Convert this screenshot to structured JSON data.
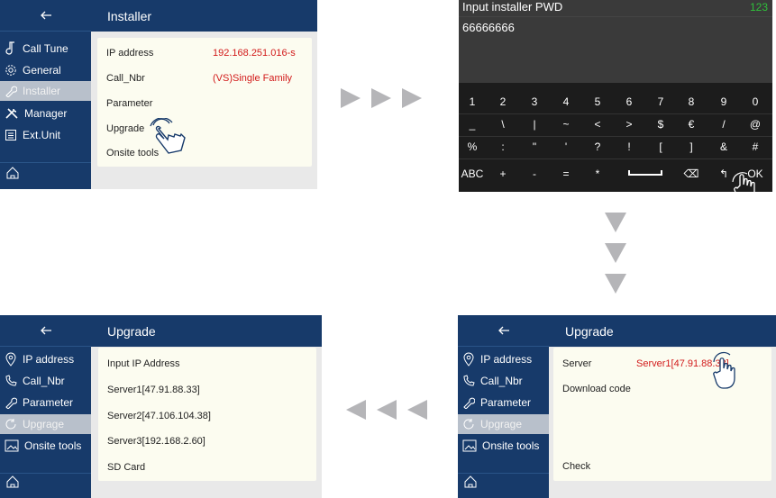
{
  "installer_screen": {
    "title": "Installer",
    "back_icon": "back-arrow-icon",
    "sidebar": [
      {
        "label": "Call Tune",
        "icon": "music-note-icon"
      },
      {
        "label": "General",
        "icon": "gear-icon"
      },
      {
        "label": "Installer",
        "icon": "wrench-icon",
        "active": true
      },
      {
        "label": "Manager",
        "icon": "tools-icon"
      },
      {
        "label": "Ext.Unit",
        "icon": "list-icon"
      }
    ],
    "rows": [
      {
        "label": "IP address",
        "value": "192.168.251.016-s"
      },
      {
        "label": "Call_Nbr",
        "value": "(VS)Single Family"
      },
      {
        "label": "Parameter",
        "value": ""
      },
      {
        "label": "Upgrade",
        "value": ""
      },
      {
        "label": "Onsite tools",
        "value": ""
      }
    ]
  },
  "keyboard_screen": {
    "title": "Input installer PWD",
    "mode": "123",
    "input_value": "66666666",
    "rows": [
      [
        "1",
        "2",
        "3",
        "4",
        "5",
        "6",
        "7",
        "8",
        "9",
        "0"
      ],
      [
        "_",
        "\\",
        "|",
        "~",
        "<",
        ">",
        "$",
        "€",
        "/",
        "@"
      ],
      [
        "%",
        ":",
        "\"",
        "'",
        "?",
        "!",
        "[",
        "]",
        "&",
        "#"
      ],
      [
        "ABC",
        "+",
        "-",
        "=",
        "*",
        "",
        "",
        "⌫",
        "↰",
        "OK"
      ]
    ]
  },
  "upgrade_left": {
    "title": "Upgrade",
    "sidebar": [
      {
        "label": "IP address",
        "icon": "location-pin-icon"
      },
      {
        "label": "Call_Nbr",
        "icon": "phone-icon"
      },
      {
        "label": "Parameter",
        "icon": "wrench-icon"
      },
      {
        "label": "Upgrage",
        "icon": "refresh-icon",
        "active": true
      },
      {
        "label": "Onsite tools",
        "icon": "picture-icon"
      }
    ],
    "rows": [
      "Input IP Address",
      "Server1[47.91.88.33]",
      "Server2[47.106.104.38]",
      "Server3[192.168.2.60]",
      "SD Card"
    ]
  },
  "upgrade_right": {
    "title": "Upgrade",
    "sidebar": [
      {
        "label": "IP address",
        "icon": "location-pin-icon"
      },
      {
        "label": "Call_Nbr",
        "icon": "phone-icon"
      },
      {
        "label": "Parameter",
        "icon": "wrench-icon"
      },
      {
        "label": "Upgrage",
        "icon": "refresh-icon",
        "active": true
      },
      {
        "label": "Onsite tools",
        "icon": "picture-icon"
      }
    ],
    "server_label": "Server",
    "server_value": "Server1[47.91.88.33]",
    "download_label": "Download code",
    "check_label": "Check"
  },
  "colors": {
    "nav": "#173a6a",
    "active": "#b8c0cb",
    "content_bg": "#fcfcf0",
    "value_red": "#d21a1a",
    "arrow_gray": "#b5b5b8",
    "keyboard_bg": "#1c1c1c",
    "mode_green": "#2fbf3a"
  }
}
